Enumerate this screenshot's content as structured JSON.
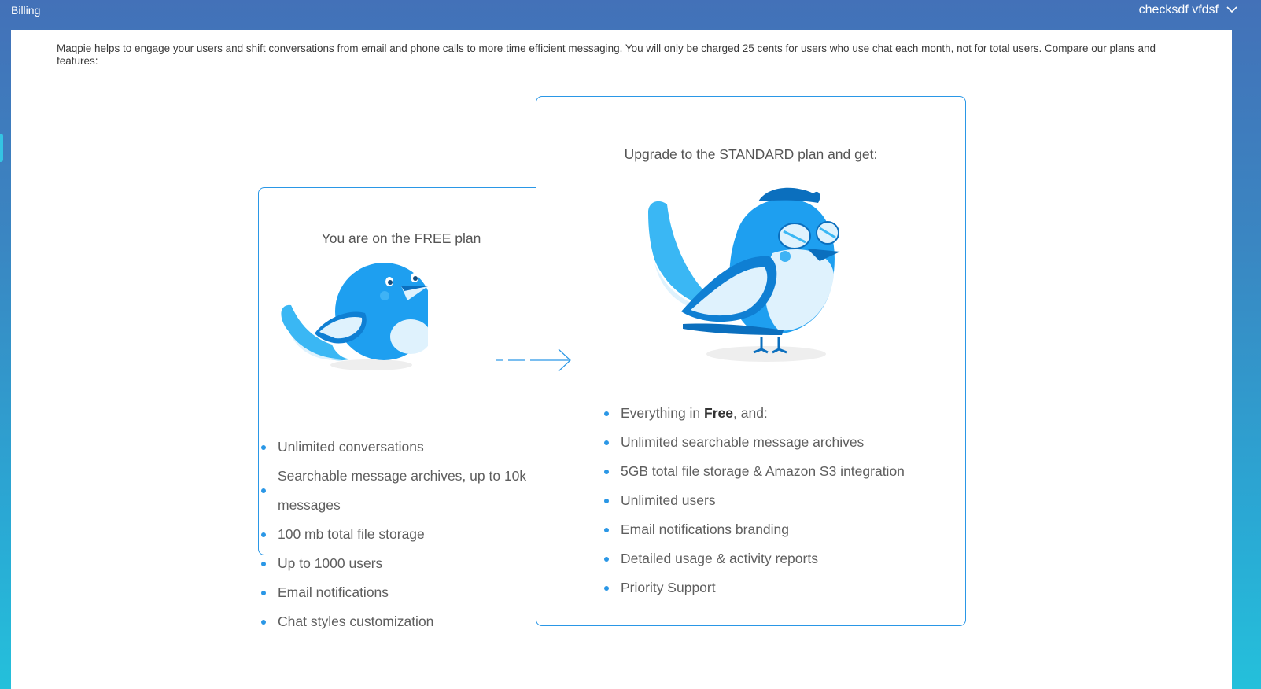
{
  "header": {
    "title": "Billing",
    "user_name": "checksdf vfdsf"
  },
  "intro": "Maqpie helps to engage your users and shift conversations from email and phone calls to more time efficient messaging. You will only be charged 25 cents for users who use chat each month, not for total users. Compare our plans and features:",
  "free_plan": {
    "heading": "You are on the FREE plan",
    "features": [
      "Unlimited conversations",
      "Searchable message archives, up to 10k messages",
      "100 mb total file storage",
      "Up to 1000 users",
      "Email notifications",
      "Chat styles customization"
    ]
  },
  "standard_plan": {
    "heading": "Upgrade to the STANDARD plan and get:",
    "first_feature": {
      "prefix": "Everything in ",
      "bold": "Free",
      "suffix": ", and:"
    },
    "features": [
      "Unlimited searchable message archives",
      "5GB total file storage & Amazon S3 integration",
      "Unlimited users",
      "Email notifications branding",
      "Detailed usage & activity reports",
      "Priority Support"
    ]
  },
  "colors": {
    "accent": "#2a97e6",
    "bird_blue": "#1e9ff0",
    "bird_light": "#dff2fd"
  },
  "icons": {
    "user_menu": "chevron-down-icon",
    "upgrade": "arrow-right-icon"
  }
}
